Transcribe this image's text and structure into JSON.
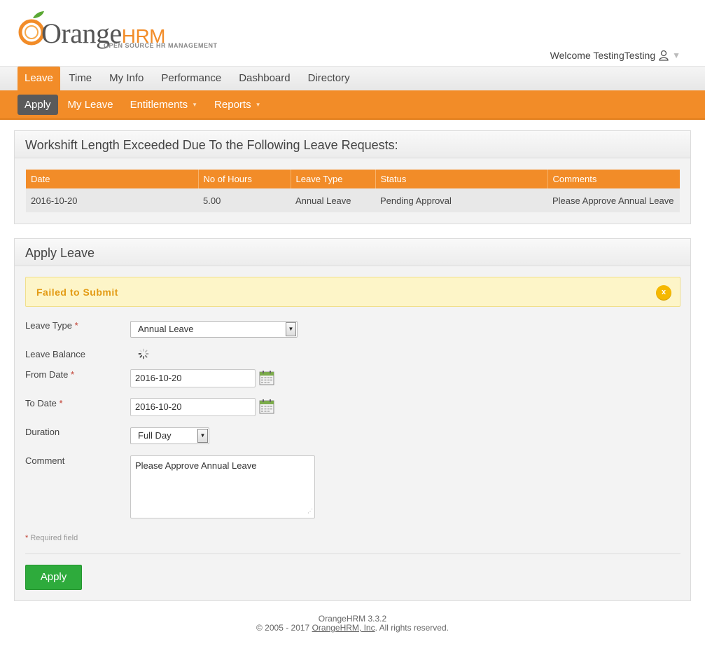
{
  "header": {
    "brand_name": "Orange",
    "brand_hrm": "HRM",
    "tagline": "OPEN SOURCE HR MANAGEMENT",
    "welcome_text": "Welcome TestingTesting"
  },
  "main_nav": {
    "items": [
      "Leave",
      "Time",
      "My Info",
      "Performance",
      "Dashboard",
      "Directory"
    ],
    "active": "Leave"
  },
  "sub_nav": {
    "items": [
      "Apply",
      "My Leave",
      "Entitlements",
      "Reports"
    ],
    "active": "Apply"
  },
  "overlap_panel": {
    "title": "Workshift Length Exceeded Due To the Following Leave Requests:",
    "columns": [
      "Date",
      "No of Hours",
      "Leave Type",
      "Status",
      "Comments"
    ],
    "rows": [
      [
        "2016-10-20",
        "5.00",
        "Annual Leave",
        "Pending Approval",
        "Please Approve Annual Leave"
      ]
    ]
  },
  "apply_panel": {
    "title": "Apply Leave",
    "alert_text": "Failed to Submit",
    "alert_close": "x",
    "leave_type_label": "Leave Type",
    "leave_type_value": "Annual Leave",
    "leave_balance_label": "Leave Balance",
    "from_date_label": "From Date",
    "from_date_value": "2016-10-20",
    "to_date_label": "To Date",
    "to_date_value": "2016-10-20",
    "duration_label": "Duration",
    "duration_value": "Full Day",
    "comment_label": "Comment",
    "comment_value": "Please Approve Annual Leave",
    "required_star": "*",
    "required_note": "Required field",
    "apply_button": "Apply"
  },
  "footer": {
    "version": "OrangeHRM 3.3.2",
    "copyright_prefix": "© 2005 - 2017 ",
    "company_link": "OrangeHRM, Inc",
    "copyright_suffix": ". All rights reserved."
  },
  "colors": {
    "brand_orange": "#f28c28",
    "apply_green": "#2eab3c",
    "alert_bg": "#fdf5c8",
    "alert_text": "#e39b15"
  }
}
